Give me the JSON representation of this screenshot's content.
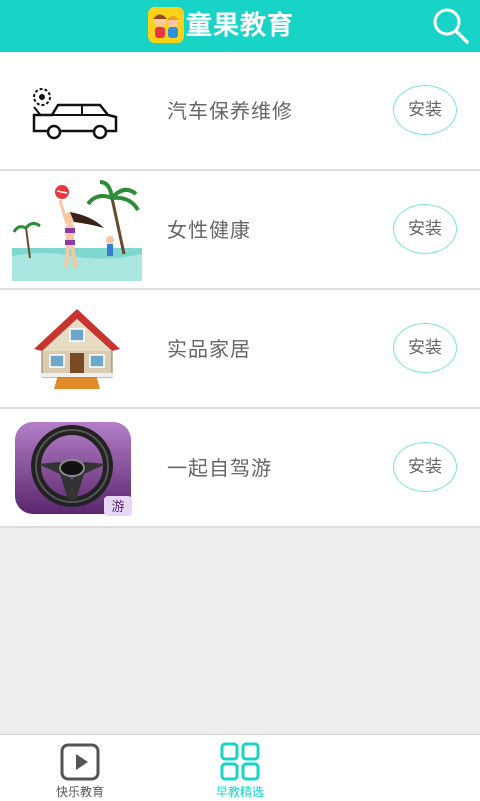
{
  "header": {
    "title": "童果教育",
    "logo_icon": "kids-logo-icon",
    "search_icon": "search-icon"
  },
  "apps": [
    {
      "name": "汽车保养维修",
      "button": "安装",
      "icon": "car-service-icon"
    },
    {
      "name": "女性健康",
      "button": "安装",
      "icon": "beach-woman-icon"
    },
    {
      "name": "实品家居",
      "button": "安装",
      "icon": "house-icon"
    },
    {
      "name": "一起自驾游",
      "button": "安装",
      "icon": "steering-wheel-icon"
    }
  ],
  "tabs": [
    {
      "label": "快乐教育",
      "icon": "play-icon",
      "active": false
    },
    {
      "label": "早教精选",
      "icon": "grid-icon",
      "active": true
    }
  ],
  "colors": {
    "accent": "#17d4c7",
    "install_border": "#7fe3dc",
    "text": "#666666"
  }
}
